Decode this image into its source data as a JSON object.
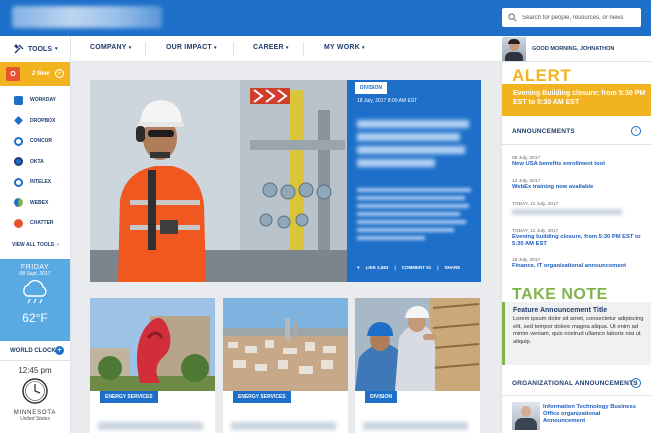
{
  "search": {
    "placeholder": "Search for people, resources, or news"
  },
  "nav": {
    "tools": "TOOLS",
    "items": [
      {
        "label": "COMPANY"
      },
      {
        "label": "OUR IMPACT"
      },
      {
        "label": "CAREER"
      },
      {
        "label": "MY WORK"
      }
    ],
    "greeting": "GOOD MORNING, JOHNATHON"
  },
  "sidebar": {
    "mail": {
      "icon": "office-icon",
      "letter": "O",
      "new_label": "2 New"
    },
    "tools": [
      {
        "label": "WORKDAY",
        "icon": "workday-icon",
        "color": "#1d6fc9"
      },
      {
        "label": "DROPBOX",
        "icon": "dropbox-icon",
        "color": "#1d6fc9"
      },
      {
        "label": "CONCUR",
        "icon": "concur-icon",
        "color": "#1d6fc9"
      },
      {
        "label": "OKTA",
        "icon": "okta-icon",
        "color": "#1f3d6e"
      },
      {
        "label": "INTELEX",
        "icon": "intelex-icon",
        "color": "#1d6fc9"
      },
      {
        "label": "WEBEX",
        "icon": "webex-icon",
        "color": "#80b44a"
      },
      {
        "label": "CHATTER",
        "icon": "chatter-icon",
        "color": "#e8542f"
      }
    ],
    "view_all": "VIEW ALL TOOLS",
    "weather": {
      "day": "FRIDAY",
      "date": "08 Sept, 2017",
      "temp": "62°F",
      "icon": "cloud-rain-icon"
    },
    "world_clock": {
      "label": "WORLD CLOCK",
      "time": "12:45 pm",
      "city": "MINNESOTA",
      "country": "United States"
    }
  },
  "hero": {
    "tag": "DIVISION",
    "date": "18 July, 2017    8:00 AM EST",
    "like": "LIKE 2,583",
    "comment": "COMMENT 51",
    "share": "SHARE"
  },
  "cards": [
    {
      "tag": "ENERGY SERVICES"
    },
    {
      "tag": "ENERGY SERVICES"
    },
    {
      "tag": "DIVISION"
    }
  ],
  "alert": {
    "heading": "ALERT",
    "text": "Evening Building closure: from 5:30 PM EST to 5:30 AM EST"
  },
  "announcements": {
    "heading": "ANNOUNCEMENTS",
    "items": [
      {
        "date": "08 July, 2017",
        "title": "New USA benefits enrollment tool"
      },
      {
        "date": "12 July, 2017",
        "title": "WebEx training now available"
      },
      {
        "date": "TODAY, 12 July, 2017",
        "title": ""
      },
      {
        "date": "TODAY, 12 July, 2017",
        "title": "Evening building closure, from 5:30 PM EST to 5:30 AM EST"
      },
      {
        "date": "18 July, 2017",
        "title": "Finance, IT organizational announcement"
      }
    ]
  },
  "take_note": {
    "heading": "TAKE NOTE",
    "title": "Feature Announcement Title",
    "body": "Lorem ipsum dolor sit amet, consectetur adipiscing elit, sed tempor dolore magna aliqua. Ut enim ad minim veniam, quis nostrud ullamco laboris nisi ut aliquip."
  },
  "org": {
    "heading": "ORGANIZATIONAL ANNOUNCEMENTS",
    "title": "Information Technology Business Office organizational Announcement"
  },
  "colors": {
    "brand": "#1d6fc9",
    "navy": "#1f3d6e",
    "alert": "#f2b320",
    "note": "#80b44a"
  }
}
